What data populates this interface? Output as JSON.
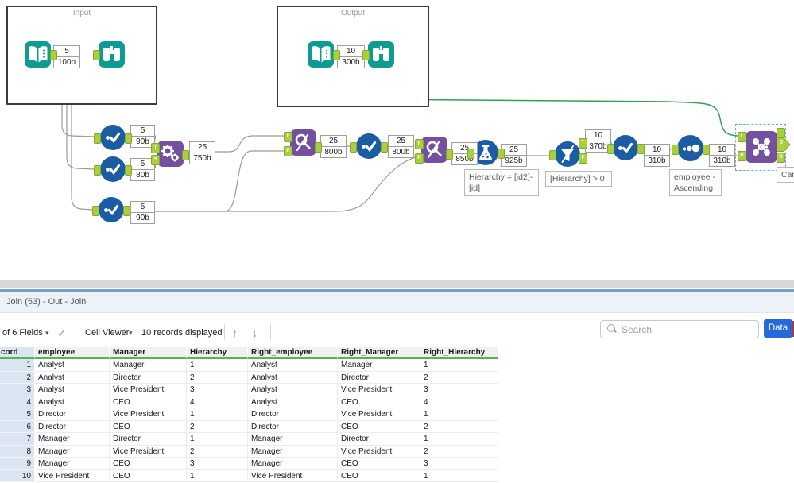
{
  "canvas": {
    "containers": {
      "input": "Input",
      "output": "Output"
    },
    "ports": {
      "t": "T",
      "s": "S",
      "f": "F",
      "r": "R",
      "l": "L",
      "j": "J"
    },
    "badges": {
      "b_input": {
        "count": "5",
        "size": "100b"
      },
      "b_output": {
        "count": "10",
        "size": "300b"
      },
      "b_sel1": {
        "count": "5",
        "size": "90b"
      },
      "b_sel2": {
        "count": "5",
        "size": "80b"
      },
      "b_sel3": {
        "count": "5",
        "size": "90b"
      },
      "b_append": {
        "count": "25",
        "size": "750b"
      },
      "b_fr1": {
        "count": "25",
        "size": "800b"
      },
      "b_sel4": {
        "count": "25",
        "size": "800b"
      },
      "b_fr2": {
        "count": "25",
        "size": "850b"
      },
      "b_formula": {
        "count": "25",
        "size": "925b"
      },
      "b_filter": {
        "count": "10",
        "size": "370b"
      },
      "b_sel5": {
        "count": "10",
        "size": "310b"
      },
      "b_sort": {
        "count": "10",
        "size": "310b"
      }
    },
    "annotations": {
      "formula_line1": "Hierarchy = [id2]-",
      "formula_line2": "[id]",
      "filter": "[Hierarchy] > 0",
      "sort_line1": "employee -",
      "sort_line2": "Ascending",
      "join_partial": "Car"
    }
  },
  "results_panel": {
    "title": "Join (53) - Out - Join",
    "toolbar": {
      "fields_label": "of 6 Fields",
      "cell_viewer_label": "Cell Viewer",
      "records_label": "10 records displayed",
      "caret": "▾",
      "check": "✓",
      "up_arrow": "↑",
      "down_arrow": "↓",
      "search_placeholder": "Search",
      "data_button": "Data"
    },
    "table": {
      "columns": [
        "cord",
        "employee",
        "Manager",
        "Hierarchy",
        "Right_employee",
        "Right_Manager",
        "Right_Hierarchy"
      ],
      "rows": [
        [
          "1",
          "Analyst",
          "Manager",
          "1",
          "Analyst",
          "Manager",
          "1"
        ],
        [
          "2",
          "Analyst",
          "Director",
          "2",
          "Analyst",
          "Director",
          "2"
        ],
        [
          "3",
          "Analyst",
          "Vice President",
          "3",
          "Analyst",
          "Vice President",
          "3"
        ],
        [
          "4",
          "Analyst",
          "CEO",
          "4",
          "Analyst",
          "CEO",
          "4"
        ],
        [
          "5",
          "Director",
          "Vice President",
          "1",
          "Director",
          "Vice President",
          "1"
        ],
        [
          "6",
          "Director",
          "CEO",
          "2",
          "Director",
          "CEO",
          "2"
        ],
        [
          "7",
          "Manager",
          "Director",
          "1",
          "Manager",
          "Director",
          "1"
        ],
        [
          "8",
          "Manager",
          "Vice President",
          "2",
          "Manager",
          "Vice President",
          "2"
        ],
        [
          "9",
          "Manager",
          "CEO",
          "3",
          "Manager",
          "CEO",
          "3"
        ],
        [
          "10",
          "Vice President",
          "CEO",
          "1",
          "Vice President",
          "CEO",
          "1"
        ]
      ]
    }
  },
  "colors": {
    "tool_teal": "#0E9C92",
    "tool_blue": "#1B5CA5",
    "tool_purple": "#74519E",
    "port_green": "#A9CF3D",
    "wire_gray": "#9A9A9A",
    "wire_green": "#2EA150",
    "data_button_blue": "#2569D8",
    "header_underline_green": "#53B84C"
  }
}
